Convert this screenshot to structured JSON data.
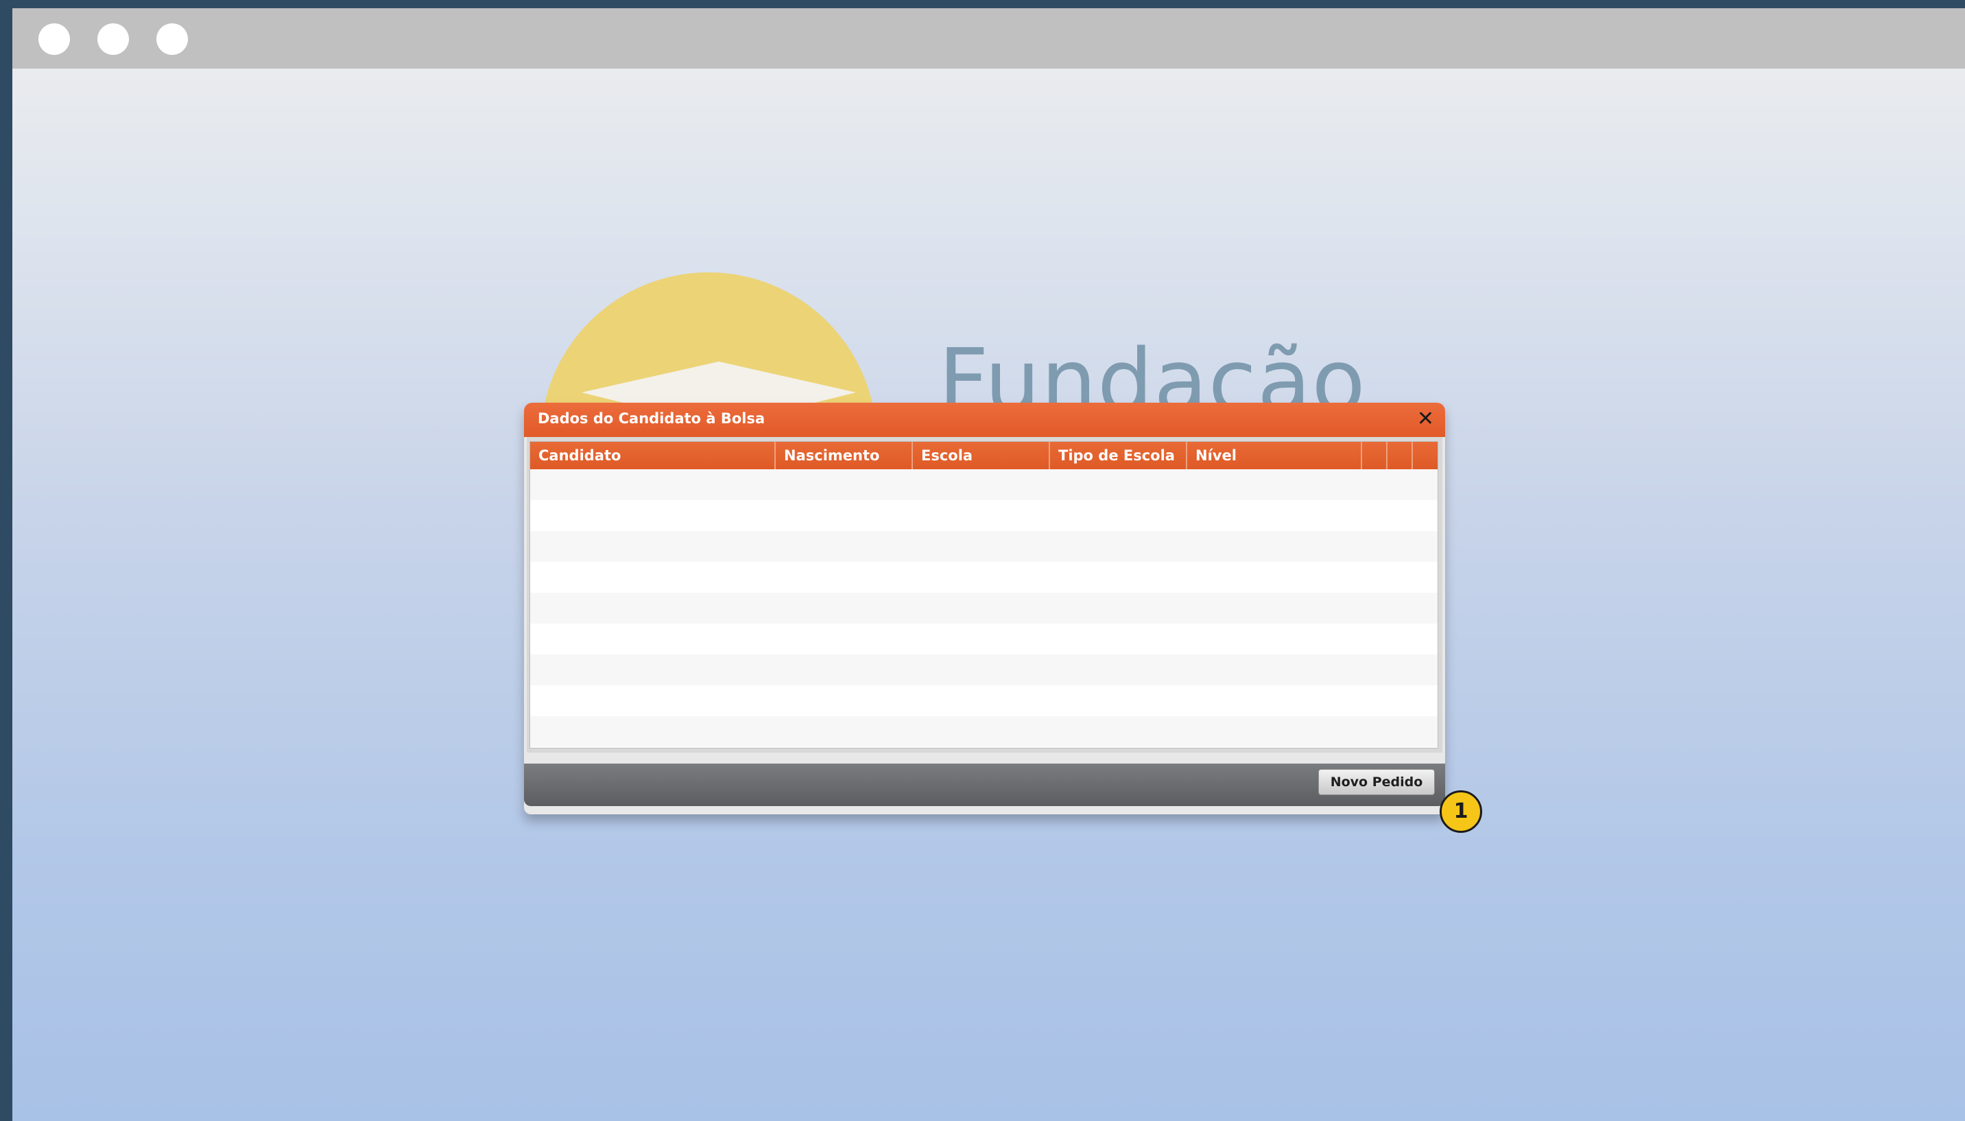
{
  "window": {
    "controls": [
      "close",
      "minimize",
      "maximize"
    ]
  },
  "background": {
    "logo_text": "Fundacão",
    "logo_colors": {
      "circle": "#ecd376",
      "text": "#7f9bb0"
    }
  },
  "dialog": {
    "title": "Dados do Candidato à Bolsa",
    "close_icon": "close-icon",
    "columns": [
      "Candidato",
      "Nascimento",
      "Escola",
      "Tipo de Escola",
      "Nível",
      "",
      "",
      ""
    ],
    "rows": [],
    "visible_empty_rows": 9,
    "header_color": "#e15a28"
  },
  "footer": {
    "new_request_label": "Novo Pedido"
  },
  "annotation": {
    "callout_label": "1",
    "callout_color": "#f5c518"
  }
}
